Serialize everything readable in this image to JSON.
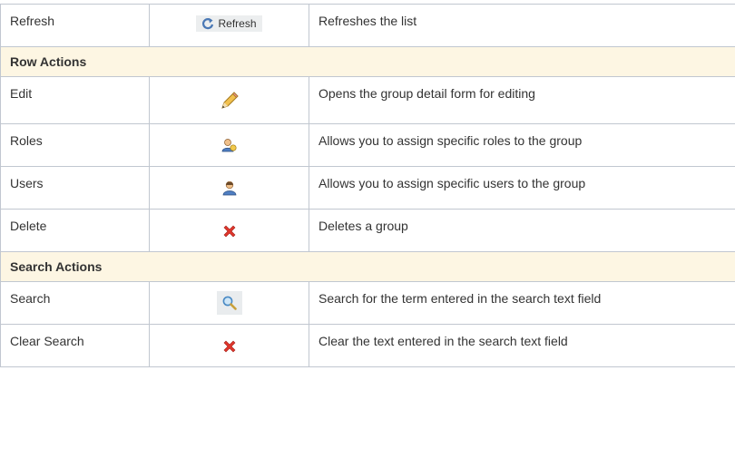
{
  "rows": [
    {
      "name": "Refresh",
      "icon_label": "Refresh",
      "desc": "Refreshes the list"
    },
    {
      "section": "Row Actions"
    },
    {
      "name": "Edit",
      "desc": "Opens the group detail form for editing"
    },
    {
      "name": "Roles",
      "desc": "Allows you to assign specific roles to the group"
    },
    {
      "name": "Users",
      "desc": "Allows you to assign specific users to the group"
    },
    {
      "name": "Delete",
      "desc": "Deletes a group"
    },
    {
      "section": "Search Actions"
    },
    {
      "name": "Search",
      "desc": "Search for the term entered in the search text field"
    },
    {
      "name": "Clear Search",
      "desc": "Clear the text entered in the search text field"
    }
  ],
  "icons": {
    "refresh": "refresh-icon",
    "edit": "pencil-icon",
    "roles": "users-roles-icon",
    "users": "user-icon",
    "delete": "red-x-icon",
    "search": "magnifier-icon",
    "clear": "red-x-icon"
  },
  "colors": {
    "section_bg": "#fdf6e3",
    "border": "#c1c7d0",
    "delete_red": "#e0352b"
  }
}
